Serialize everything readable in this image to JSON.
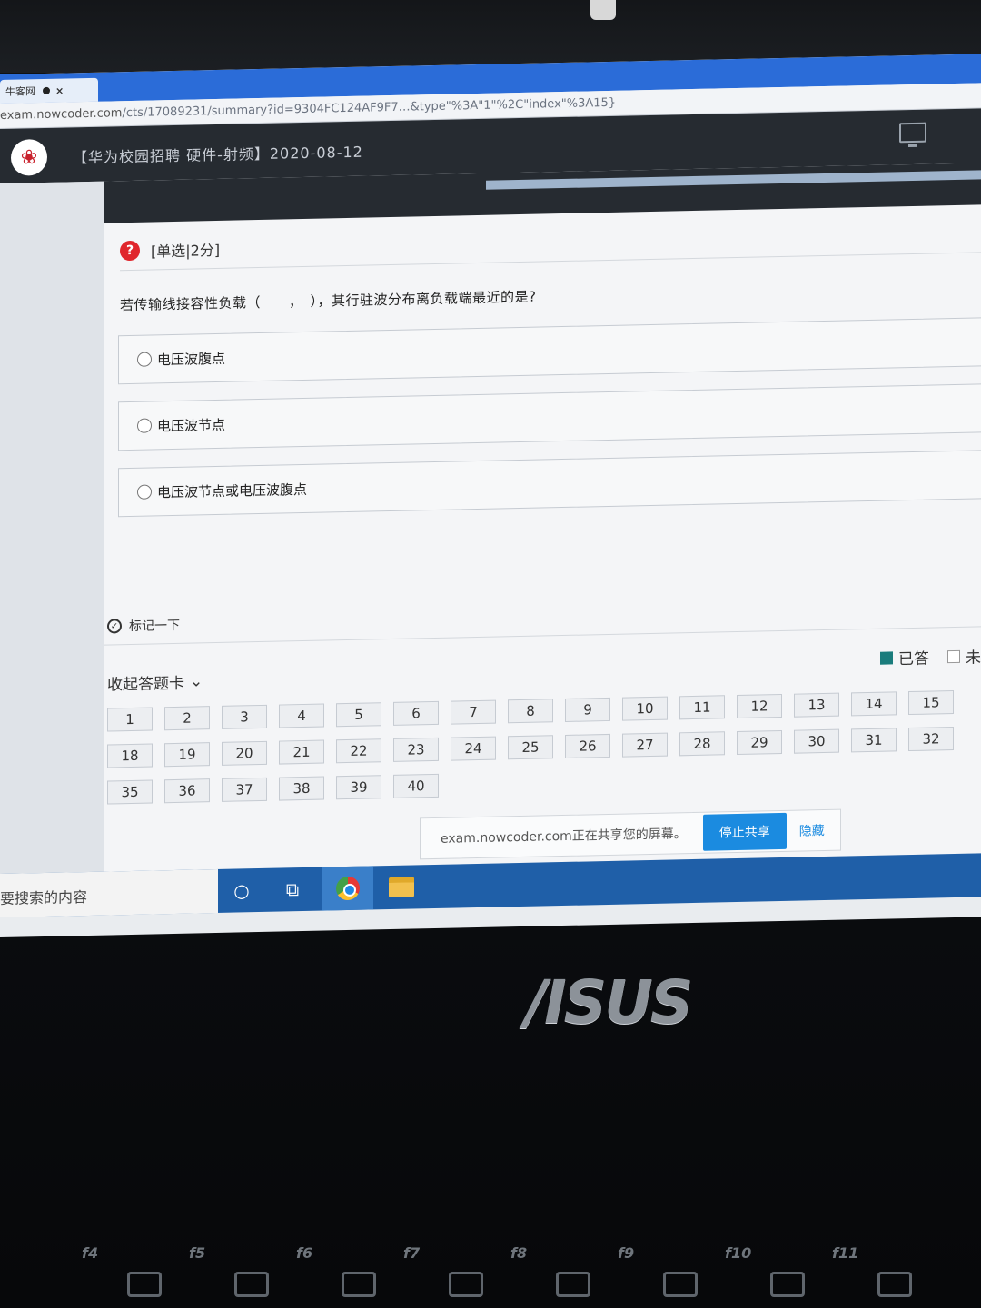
{
  "browser": {
    "tab_label": "牛客网",
    "tab_close": "×",
    "url_host": "exam.nowcoder.com",
    "url_path": "/cts/17089231/summary?id=9304FC124AF9F7…&type\"%3A\"1\"%2C\"index\"%3A15}"
  },
  "header": {
    "logo_glyph": "❀",
    "title": "【华为校园招聘 硬件-射频】2020-08-12"
  },
  "question": {
    "type_label": "[单选|2分]",
    "help_glyph": "?",
    "text": "若传输线接容性负载（　　，　），其行驻波分布离负载端最近的是?",
    "options": [
      {
        "label": "电压波腹点"
      },
      {
        "label": "电压波节点"
      },
      {
        "label": "电压波节点或电压波腹点"
      }
    ],
    "mark_label": "标记一下"
  },
  "answer_card": {
    "toggle_label": "收起答题卡",
    "toggle_chevron": "⌄",
    "legend_done": "已答",
    "legend_todo": "未",
    "numbers": [
      "1",
      "2",
      "3",
      "4",
      "5",
      "6",
      "7",
      "8",
      "9",
      "10",
      "11",
      "12",
      "13",
      "14",
      "15",
      "18",
      "19",
      "20",
      "21",
      "22",
      "23",
      "24",
      "25",
      "26",
      "27",
      "28",
      "29",
      "30",
      "31",
      "32",
      "35",
      "36",
      "37",
      "38",
      "39",
      "40"
    ]
  },
  "share_banner": {
    "message": "exam.nowcoder.com正在共享您的屏幕。",
    "stop_label": "停止共享",
    "hide_label": "隐藏"
  },
  "taskbar": {
    "search_placeholder": "要搜索的内容",
    "cortana_glyph": "○",
    "taskview_glyph": "⧉"
  },
  "laptop": {
    "brand": "/ISUS"
  },
  "keyboard": {
    "fkeys": [
      "f4",
      "f5",
      "f6",
      "f7",
      "f8",
      "f9",
      "f10",
      "f11"
    ]
  }
}
